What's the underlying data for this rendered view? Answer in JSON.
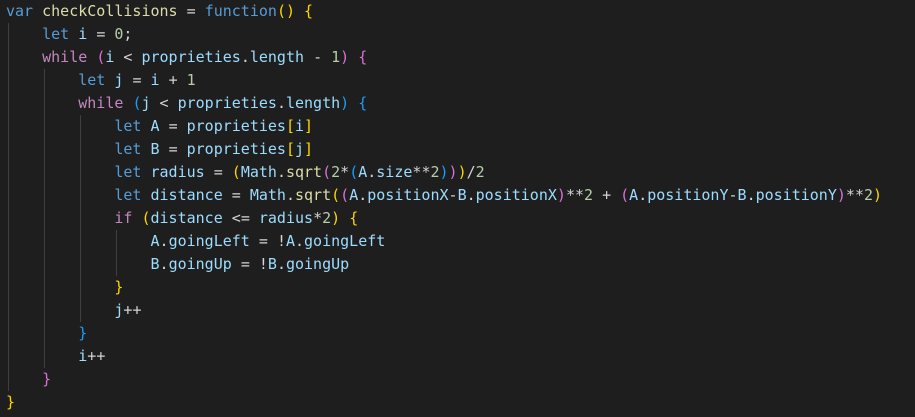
{
  "code": {
    "language": "javascript",
    "lines": [
      "var checkCollisions = function() {",
      "    let i = 0;",
      "    while (i < proprieties.length - 1) {",
      "        let j = i + 1",
      "        while (j < proprieties.length) {",
      "            let A = proprieties[i]",
      "            let B = proprieties[j]",
      "            let radius = (Math.sqrt(2*(A.size**2)))/2",
      "            let distance = Math.sqrt((A.positionX-B.positionX)**2 + (A.positionY-B.positionY)**2)",
      "            if (distance <= radius*2) {",
      "                A.goingLeft = !A.goingLeft",
      "                B.goingUp = !B.goingUp",
      "            }",
      "            j++",
      "        }",
      "        i++",
      "    }",
      "}"
    ]
  },
  "theme": {
    "background": "#1e1e1e",
    "keyword": "#569cd6",
    "control": "#c586c0",
    "variable": "#9cdcfe",
    "function": "#dcdcaa",
    "number": "#b5cea8",
    "bracket_level1": "#ffd700",
    "bracket_level2": "#da70d6",
    "bracket_level3": "#179fff",
    "indent_guide": "#404040"
  }
}
